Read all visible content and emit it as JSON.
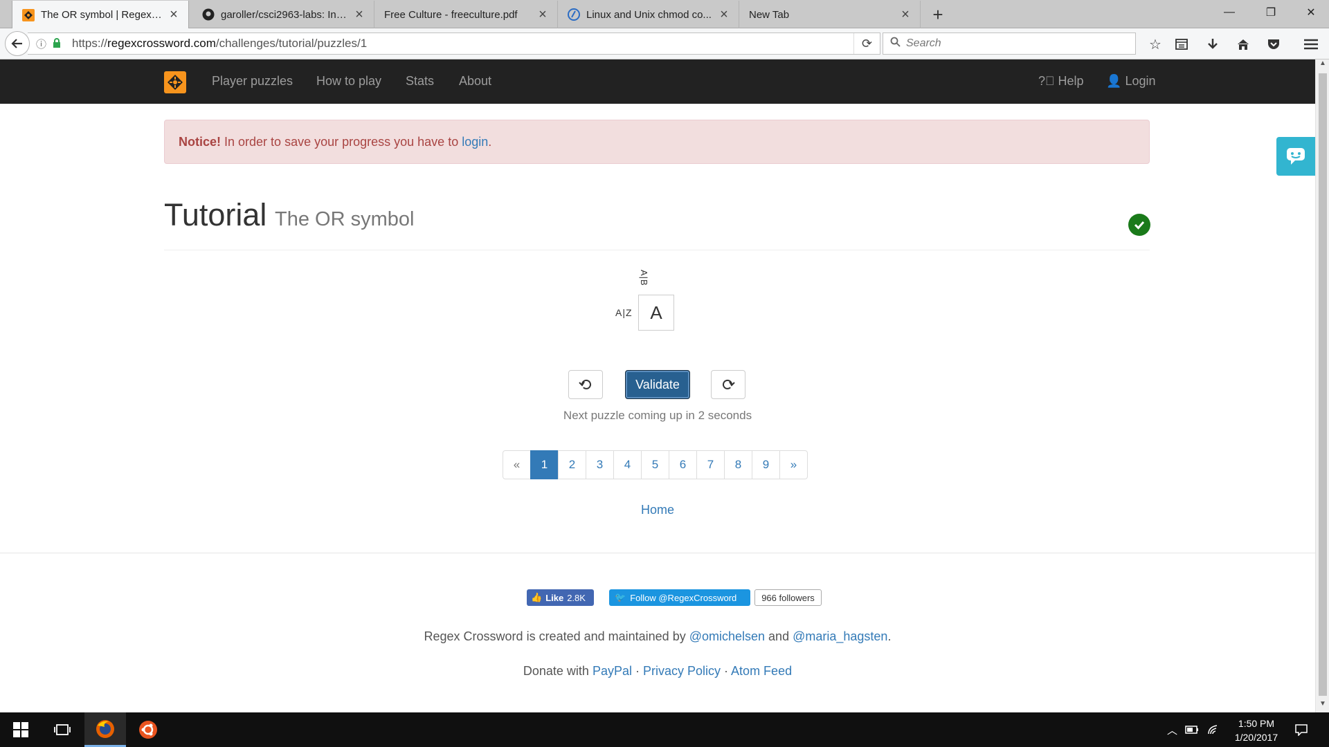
{
  "browser": {
    "tabs": [
      {
        "label": "The OR symbol | Regex Cr...",
        "active": true
      },
      {
        "label": "garoller/csci2963-labs: Int..."
      },
      {
        "label": "Free Culture - freeculture.pdf"
      },
      {
        "label": "Linux and Unix chmod co..."
      },
      {
        "label": "New Tab"
      }
    ],
    "url_prefix": "https://",
    "url_domain": "regexcrossword.com",
    "url_path": "/challenges/tutorial/puzzles/1",
    "search_placeholder": "Search"
  },
  "site": {
    "nav": [
      "Player puzzles",
      "How to play",
      "Stats",
      "About"
    ],
    "help": "Help",
    "login": "Login",
    "accent_color": "#f7941d"
  },
  "notice": {
    "strong": "Notice!",
    "text": " In order to save your progress you have to ",
    "link": "login",
    "end": "."
  },
  "puzzle": {
    "title": "Tutorial",
    "subtitle": "The OR symbol",
    "col_clue": "A|B",
    "row_clue": "A|Z",
    "cell_value": "A",
    "validate": "Validate",
    "next_msg": "Next puzzle coming up in 2 seconds",
    "pages": [
      "«",
      "1",
      "2",
      "3",
      "4",
      "5",
      "6",
      "7",
      "8",
      "9",
      "»"
    ],
    "active_page": "1",
    "home": "Home"
  },
  "footer": {
    "fb_like": "Like",
    "fb_count": "2.8K",
    "tw_follow": "Follow @RegexCrossword",
    "tw_count": "966 followers",
    "credits_prefix": "Regex Crossword is created and maintained by ",
    "author1": "@omichelsen",
    "and": " and ",
    "author2": "@maria_hagsten",
    "period": ".",
    "donate": "Donate with ",
    "paypal": "PayPal",
    "sep": " · ",
    "privacy": "Privacy Policy",
    "atom": "Atom Feed"
  },
  "taskbar": {
    "time": "1:50 PM",
    "date": "1/20/2017"
  }
}
